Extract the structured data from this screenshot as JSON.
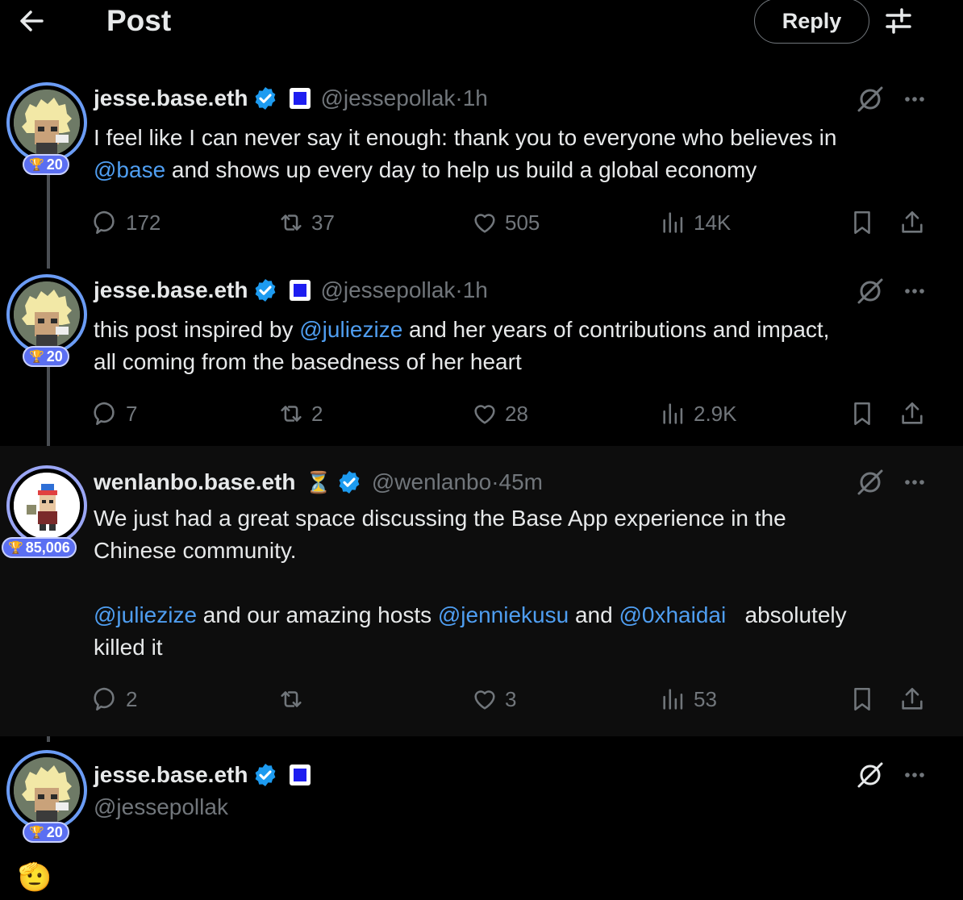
{
  "header": {
    "title": "Post",
    "reply_label": "Reply"
  },
  "posts": [
    {
      "name": "jesse.base.eth",
      "handle": "@jessepollak",
      "time_sep": " · ",
      "time": "1h",
      "badge": "20",
      "text": [
        {
          "t": "I feel like I can never say it enough: thank you to everyone who believes in\n",
          "m": false
        },
        {
          "t": "@base",
          "m": true
        },
        {
          "t": " and shows up every day to help us build a global economy",
          "m": false
        }
      ],
      "replies": "172",
      "reposts": "37",
      "likes": "505",
      "views": "14K"
    },
    {
      "name": "jesse.base.eth",
      "handle": "@jessepollak",
      "time_sep": " · ",
      "time": "1h",
      "badge": "20",
      "text": [
        {
          "t": "this post inspired by ",
          "m": false
        },
        {
          "t": "@juliezize",
          "m": true
        },
        {
          "t": " and her years of contributions and impact,\nall coming from the basedness of her heart",
          "m": false
        }
      ],
      "replies": "7",
      "reposts": "2",
      "likes": "28",
      "views": "2.9K"
    },
    {
      "name": "wenlanbo.base.eth",
      "handle": "@wenlanbo",
      "time_sep": " · ",
      "time": "45m",
      "badge": "85,006",
      "text": [
        {
          "t": "We just had a great space discussing the Base App experience in the\nChinese community.\n\n",
          "m": false
        },
        {
          "t": "@juliezize",
          "m": true
        },
        {
          "t": " and our amazing hosts ",
          "m": false
        },
        {
          "t": "@jenniekusu",
          "m": true
        },
        {
          "t": " and ",
          "m": false
        },
        {
          "t": "@0xhaidai",
          "m": true
        },
        {
          "t": "   absolutely\nkilled it",
          "m": false
        }
      ],
      "replies": "2",
      "reposts": "",
      "likes": "3",
      "views": "53"
    },
    {
      "name": "jesse.base.eth",
      "handle": "@jessepollak",
      "badge": "20",
      "emoji": "🫡"
    }
  ],
  "colors": {
    "accent": "#4f9ef1",
    "muted": "#71767b",
    "badge": "#5b6ff2",
    "verified": "#1d9bf0"
  }
}
